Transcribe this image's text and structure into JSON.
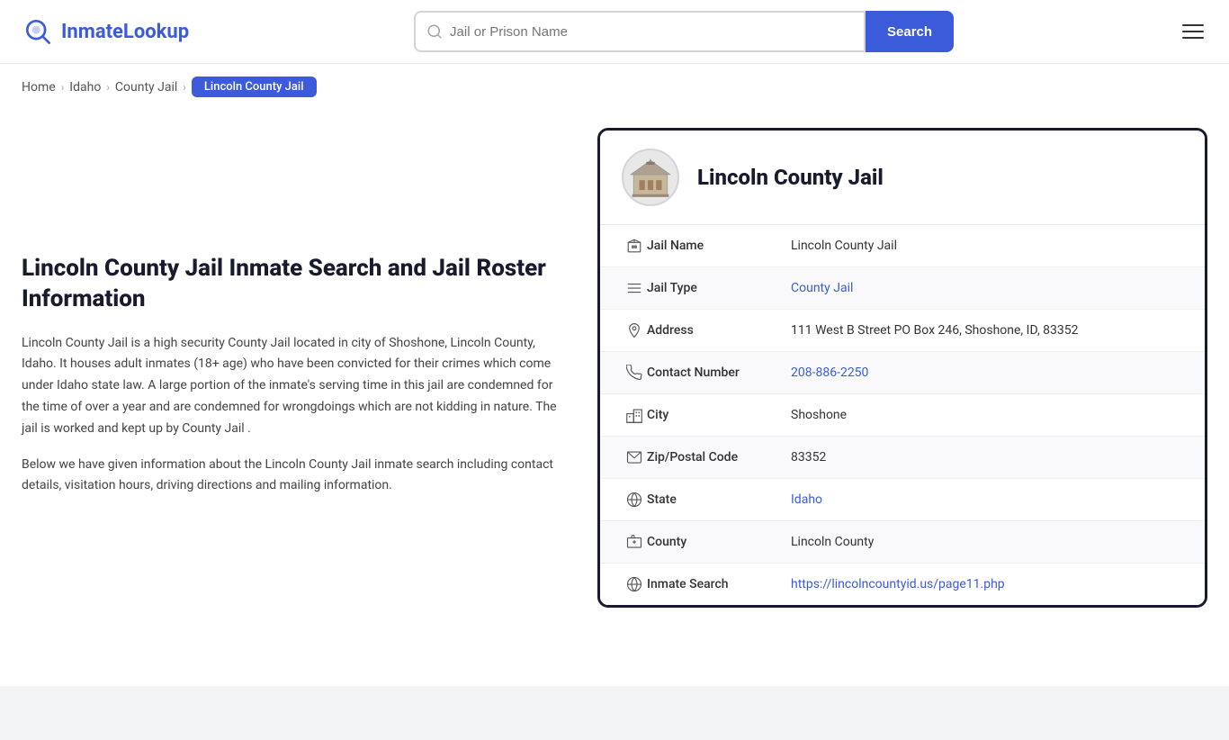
{
  "header": {
    "logo_text_part1": "Inmate",
    "logo_text_part2": "Lookup",
    "search_placeholder": "Jail or Prison Name",
    "search_button_label": "Search"
  },
  "breadcrumb": {
    "home": "Home",
    "idaho": "Idaho",
    "county_jail": "County Jail",
    "active": "Lincoln County Jail"
  },
  "left": {
    "heading": "Lincoln County Jail Inmate Search and Jail Roster Information",
    "paragraph1": "Lincoln County Jail is a high security County Jail located in city of Shoshone, Lincoln County, Idaho. It houses adult inmates (18+ age) who have been convicted for their crimes which come under Idaho state law. A large portion of the inmate's serving time in this jail are condemned for the time of over a year and are condemned for wrongdoings which are not kidding in nature. The jail is worked and kept up by County Jail .",
    "paragraph2": "Below we have given information about the Lincoln County Jail inmate search including contact details, visitation hours, driving directions and mailing information."
  },
  "card": {
    "title": "Lincoln County Jail",
    "rows": [
      {
        "icon": "building-icon",
        "label": "Jail Name",
        "value": "Lincoln County Jail",
        "link": null
      },
      {
        "icon": "list-icon",
        "label": "Jail Type",
        "value": "County Jail",
        "link": "#"
      },
      {
        "icon": "location-icon",
        "label": "Address",
        "value": "111 West B Street PO Box 246, Shoshone, ID, 83352",
        "link": null
      },
      {
        "icon": "phone-icon",
        "label": "Contact Number",
        "value": "208-886-2250",
        "link": "tel:208-886-2250"
      },
      {
        "icon": "city-icon",
        "label": "City",
        "value": "Shoshone",
        "link": null
      },
      {
        "icon": "mail-icon",
        "label": "Zip/Postal Code",
        "value": "83352",
        "link": null
      },
      {
        "icon": "globe-icon",
        "label": "State",
        "value": "Idaho",
        "link": "#"
      },
      {
        "icon": "county-icon",
        "label": "County",
        "value": "Lincoln County",
        "link": null
      },
      {
        "icon": "web-icon",
        "label": "Inmate Search",
        "value": "https://lincolncountyid.us/page11.php",
        "link": "https://lincolncountyid.us/page11.php"
      }
    ]
  },
  "icons": {
    "building": "🏛",
    "list": "☰",
    "location": "📍",
    "phone": "📞",
    "city": "🏙",
    "mail": "✉",
    "globe": "🌐",
    "county": "🗺",
    "web": "🌐"
  }
}
